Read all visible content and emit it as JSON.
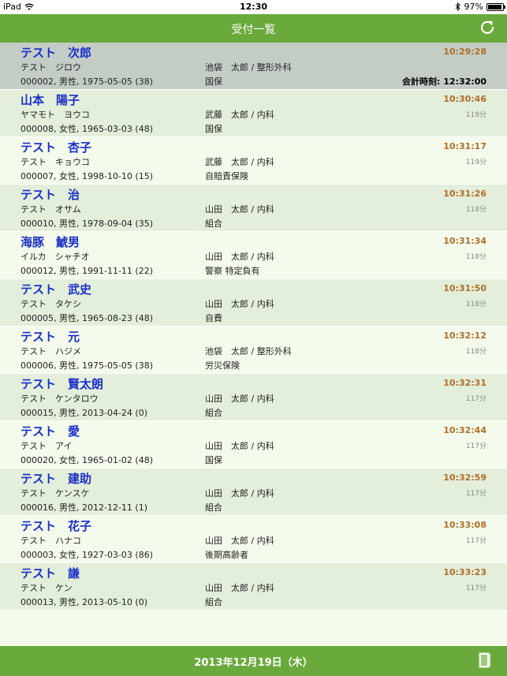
{
  "status": {
    "device": "iPad",
    "time": "12:30",
    "battery": "97%",
    "battery_level": 0.97
  },
  "nav": {
    "title": "受付一覧",
    "refresh_icon": "refresh-icon"
  },
  "rows": [
    {
      "name": "テスト　次郎",
      "kana": "テスト　ジロウ",
      "info": "000002, 男性, 1975-05-05 (38)",
      "doctor": "池袋　太郎 / 整形外科",
      "insurance": "国保",
      "time": "10:29:28",
      "wait": "",
      "checkout": "会計時刻: 12:32:00"
    },
    {
      "name": "山本　陽子",
      "kana": "ヤマモト　ヨウコ",
      "info": "000008, 女性, 1965-03-03 (48)",
      "doctor": "武藤　太郎 / 内科",
      "insurance": "国保",
      "time": "10:30:46",
      "wait": "119分",
      "checkout": ""
    },
    {
      "name": "テスト　杏子",
      "kana": "テスト　キョウコ",
      "info": "000007, 女性, 1998-10-10 (15)",
      "doctor": "武藤　太郎 / 内科",
      "insurance": "自賠責保険",
      "time": "10:31:17",
      "wait": "119分",
      "checkout": ""
    },
    {
      "name": "テスト　治",
      "kana": "テスト　オサム",
      "info": "000010, 男性, 1978-09-04 (35)",
      "doctor": "山田　太郎 / 内科",
      "insurance": "組合",
      "time": "10:31:26",
      "wait": "118分",
      "checkout": ""
    },
    {
      "name": "海豚　鯱男",
      "kana": "イルカ　シャチオ",
      "info": "000012, 男性, 1991-11-11 (22)",
      "doctor": "山田　太郎 / 内科",
      "insurance": "警察 特定負有",
      "time": "10:31:34",
      "wait": "118分",
      "checkout": ""
    },
    {
      "name": "テスト　武史",
      "kana": "テスト　タケシ",
      "info": "000005, 男性, 1965-08-23 (48)",
      "doctor": "山田　太郎 / 内科",
      "insurance": "自費",
      "time": "10:31:50",
      "wait": "118分",
      "checkout": ""
    },
    {
      "name": "テスト　元",
      "kana": "テスト　ハジメ",
      "info": "000006, 男性, 1975-05-05 (38)",
      "doctor": "池袋　太郎 / 整形外科",
      "insurance": "労災保険",
      "time": "10:32:12",
      "wait": "118分",
      "checkout": ""
    },
    {
      "name": "テスト　賢太朗",
      "kana": "テスト　ケンタロウ",
      "info": "000015, 男性, 2013-04-24 (0)",
      "doctor": "山田　太郎 / 内科",
      "insurance": "組合",
      "time": "10:32:31",
      "wait": "117分",
      "checkout": ""
    },
    {
      "name": "テスト　愛",
      "kana": "テスト　アイ",
      "info": "000020, 女性, 1965-01-02 (48)",
      "doctor": "山田　太郎 / 内科",
      "insurance": "国保",
      "time": "10:32:44",
      "wait": "117分",
      "checkout": ""
    },
    {
      "name": "テスト　建助",
      "kana": "テスト　ケンスケ",
      "info": "000016, 男性, 2012-12-11 (1)",
      "doctor": "山田　太郎 / 内科",
      "insurance": "組合",
      "time": "10:32:59",
      "wait": "117分",
      "checkout": ""
    },
    {
      "name": "テスト　花子",
      "kana": "テスト　ハナコ",
      "info": "000003, 女性, 1927-03-03 (86)",
      "doctor": "山田　太郎 / 内科",
      "insurance": "後期高齢者",
      "time": "10:33:08",
      "wait": "117分",
      "checkout": ""
    },
    {
      "name": "テスト　謙",
      "kana": "テスト　ケン",
      "info": "000013, 男性, 2013-05-10 (0)",
      "doctor": "山田　太郎 / 内科",
      "insurance": "組合",
      "time": "10:33:23",
      "wait": "117分",
      "checkout": ""
    }
  ],
  "footer": {
    "date": "2013年12月19日（木）",
    "book_icon": "book-icon"
  },
  "colors": {
    "green": "#6aaa3c",
    "name_blue": "#1a2fc8",
    "time_orange": "#b06e29",
    "selected_row": "#c3cdc6"
  }
}
